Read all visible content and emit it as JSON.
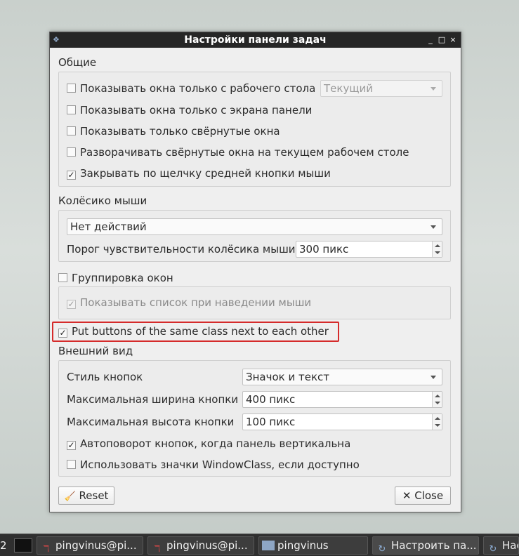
{
  "window": {
    "title": "Настройки панели задач",
    "controls": [
      "_",
      "□",
      "×"
    ]
  },
  "general": {
    "title": "Общие",
    "items": [
      {
        "label": "Показывать окна только с рабочего стола",
        "checked": false
      },
      {
        "label": "Показывать окна только с экрана панели",
        "checked": false
      },
      {
        "label": "Показывать только свёрнутые окна",
        "checked": false
      },
      {
        "label": "Разворачивать свёрнутые окна на текущем рабочем столе",
        "checked": false
      },
      {
        "label": "Закрывать по щелчку средней кнопки мыши",
        "checked": true
      }
    ],
    "desktop_combo": "Текущий"
  },
  "mouse_wheel": {
    "title": "Колёсико мыши",
    "action": "Нет действий",
    "threshold_label": "Порог чувствительности колёсика мыши",
    "threshold_value": "300 пикс"
  },
  "grouping": {
    "label": "Группировка окон",
    "checked": false,
    "hover_label": "Показывать список при наведении мыши",
    "hover_checked": true
  },
  "same_class": {
    "label": "Put buttons of the same class next to each other",
    "checked": true
  },
  "appearance": {
    "title": "Внешний вид",
    "style_label": "Стиль кнопок",
    "style_value": "Значок и текст",
    "max_width_label": "Максимальная ширина кнопки",
    "max_width_value": "400 пикс",
    "max_height_label": "Максимальная высота кнопки",
    "max_height_value": "100 пикс",
    "autorotate_label": "Автоповорот кнопок, когда панель вертикальна",
    "autorotate_checked": true,
    "windowclass_label": "Использовать значки WindowClass, если доступно",
    "windowclass_checked": false
  },
  "buttons": {
    "reset": "Reset",
    "close": "Close"
  },
  "taskbar": {
    "desktop_number": "2",
    "tasks": [
      "pingvinus@pi...",
      "pingvinus@pi...",
      "pingvinus",
      "Настроить па...",
      "Нас"
    ]
  },
  "colors": {
    "highlight": "#d52b2b",
    "titlebar": "#262626"
  }
}
